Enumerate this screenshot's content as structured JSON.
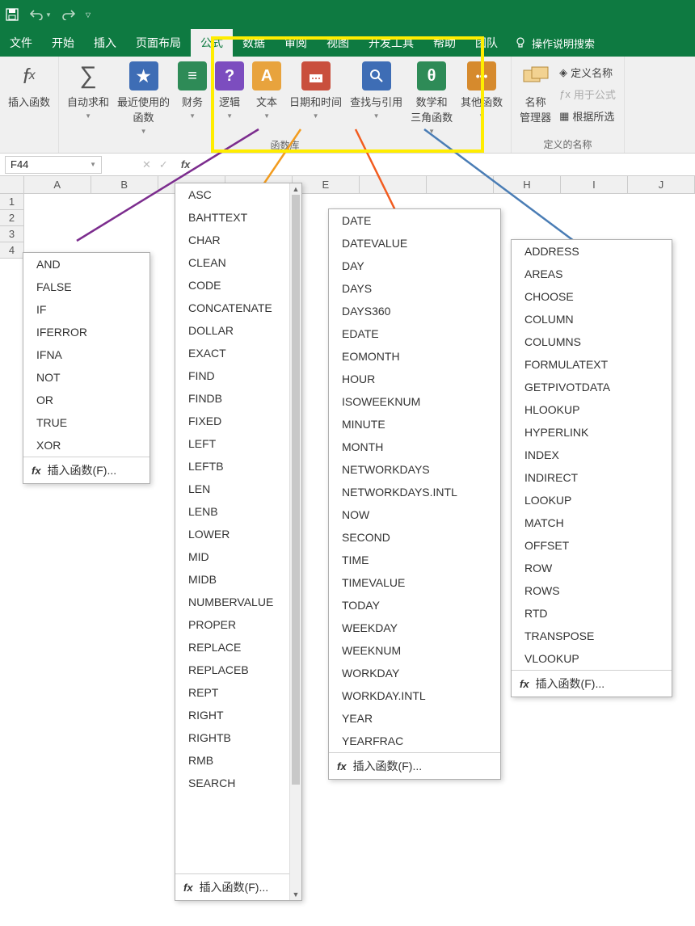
{
  "qat": {
    "save": "保存",
    "undo": "撤销",
    "redo": "重做",
    "more": "更多"
  },
  "tabs": [
    "文件",
    "开始",
    "插入",
    "页面布局",
    "公式",
    "数据",
    "审阅",
    "视图",
    "开发工具",
    "帮助",
    "团队"
  ],
  "active_tab_index": 4,
  "tell_me": "操作说明搜索",
  "ribbon": {
    "insert_fn": "插入函数",
    "autosum": "自动求和",
    "recent": "最近使用的\n函数",
    "financial": "财务",
    "logical": "逻辑",
    "text": "文本",
    "datetime": "日期和时间",
    "lookup": "查找与引用",
    "math": "数学和\n三角函数",
    "more": "其他函数",
    "name_mgr": "名称\n管理器",
    "define_name": "定义名称",
    "use_formula": "用于公式",
    "create_from": "根据所选",
    "group_fnlib": "函数库",
    "group_names": "定义的名称"
  },
  "namebox": "F44",
  "cols": [
    "A",
    "B",
    "",
    "",
    "E",
    "",
    "",
    "H",
    "I",
    "J"
  ],
  "rows": [
    "1",
    "2",
    "3",
    "4"
  ],
  "dropdown_footer": "插入函数(F)...",
  "menus": {
    "logical": [
      "AND",
      "FALSE",
      "IF",
      "IFERROR",
      "IFNA",
      "NOT",
      "OR",
      "TRUE",
      "XOR"
    ],
    "text": [
      "ASC",
      "BAHTTEXT",
      "CHAR",
      "CLEAN",
      "CODE",
      "CONCATENATE",
      "DOLLAR",
      "EXACT",
      "FIND",
      "FINDB",
      "FIXED",
      "LEFT",
      "LEFTB",
      "LEN",
      "LENB",
      "LOWER",
      "MID",
      "MIDB",
      "NUMBERVALUE",
      "PROPER",
      "REPLACE",
      "REPLACEB",
      "REPT",
      "RIGHT",
      "RIGHTB",
      "RMB",
      "SEARCH"
    ],
    "datetime": [
      "DATE",
      "DATEVALUE",
      "DAY",
      "DAYS",
      "DAYS360",
      "EDATE",
      "EOMONTH",
      "HOUR",
      "ISOWEEKNUM",
      "MINUTE",
      "MONTH",
      "NETWORKDAYS",
      "NETWORKDAYS.INTL",
      "NOW",
      "SECOND",
      "TIME",
      "TIMEVALUE",
      "TODAY",
      "WEEKDAY",
      "WEEKNUM",
      "WORKDAY",
      "WORKDAY.INTL",
      "YEAR",
      "YEARFRAC"
    ],
    "lookup": [
      "ADDRESS",
      "AREAS",
      "CHOOSE",
      "COLUMN",
      "COLUMNS",
      "FORMULATEXT",
      "GETPIVOTDATA",
      "HLOOKUP",
      "HYPERLINK",
      "INDEX",
      "INDIRECT",
      "LOOKUP",
      "MATCH",
      "OFFSET",
      "ROW",
      "ROWS",
      "RTD",
      "TRANSPOSE",
      "VLOOKUP"
    ]
  },
  "lines": {
    "logical_color": "#7c2d8e",
    "text_color": "#f29c1f",
    "datetime_color": "#f25c1f",
    "lookup_color": "#4a7db5"
  }
}
